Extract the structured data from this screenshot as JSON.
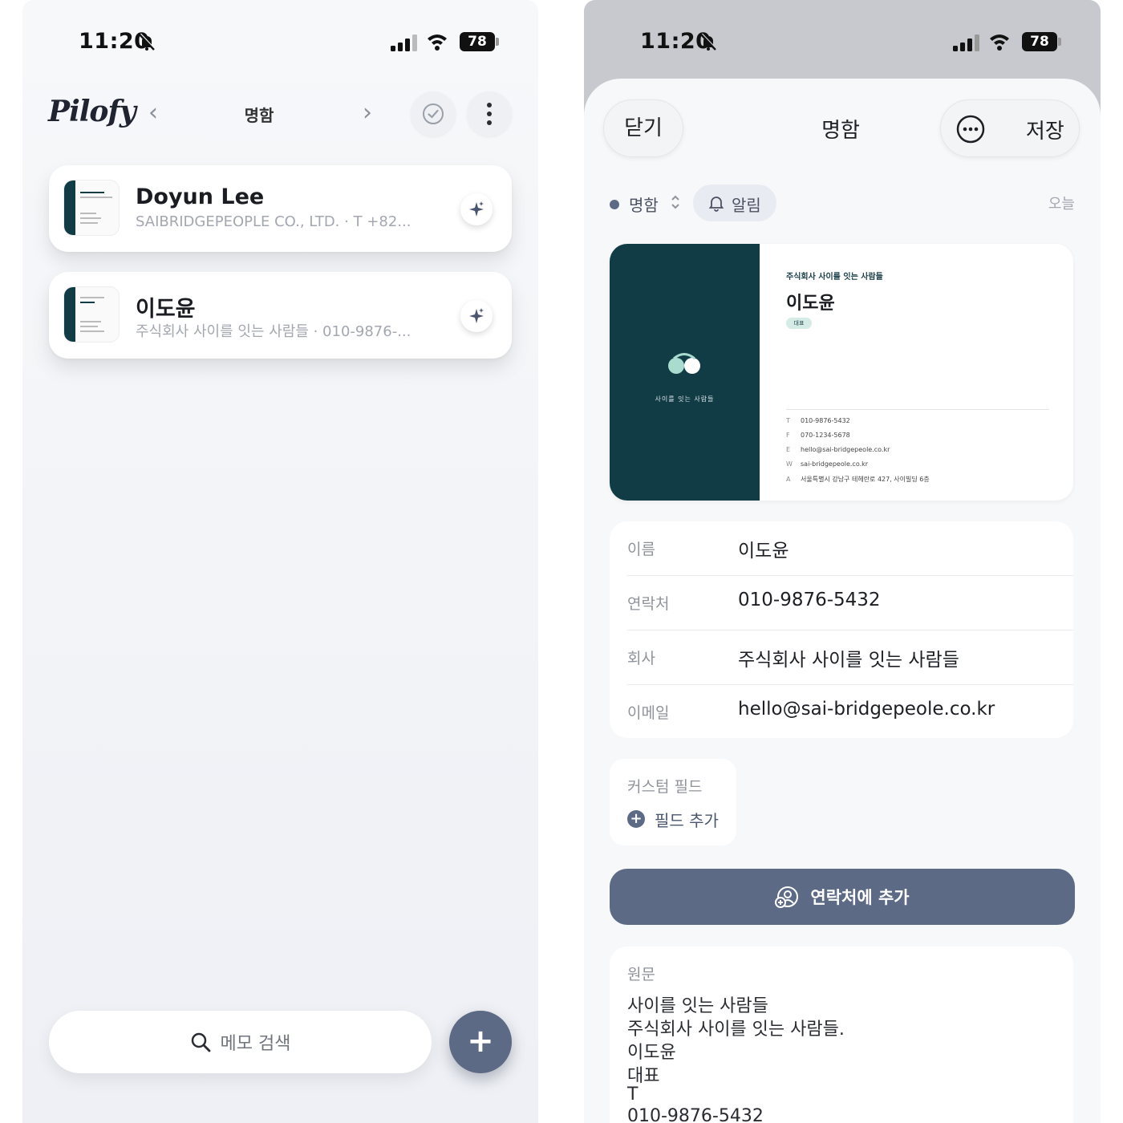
{
  "status_bar": {
    "time": "11:20",
    "battery": "78"
  },
  "left": {
    "logo": "Pilofy",
    "nav_prev": "‹",
    "nav_next": "›",
    "title": "명함",
    "cards": [
      {
        "name": "Doyun Lee",
        "subtitle": "SAIBRIDGEPEOPLE CO., LTD. · T +82..."
      },
      {
        "name": "이도윤",
        "subtitle": "주식회사 사이를 잇는 사람들 · 010-9876-..."
      }
    ],
    "search": {
      "placeholder": "메모 검색"
    },
    "fab": "+"
  },
  "right": {
    "close": "닫기",
    "title": "명함",
    "save": "저장",
    "meta": {
      "type": "명함",
      "alarm": "알림",
      "date": "오늘"
    },
    "card": {
      "dark_text": "사이를 잇는 사람들",
      "company": "주식회사 사이를 잇는 사람들",
      "name": "이도윤",
      "role": "대표",
      "lines": [
        {
          "k": "T",
          "v": "010-9876-5432"
        },
        {
          "k": "F",
          "v": "070-1234-5678"
        },
        {
          "k": "E",
          "v": "hello@sai-bridgepeole.co.kr"
        },
        {
          "k": "W",
          "v": "sai-bridgepeole.co.kr"
        },
        {
          "k": "A",
          "v": "서울특별시 강남구 테헤란로 427, 사이빌딩 6층"
        }
      ]
    },
    "fields": [
      {
        "label": "이름",
        "value": "이도윤"
      },
      {
        "label": "연락처",
        "value": "010-9876-5432"
      },
      {
        "label": "회사",
        "value": "주식회사 사이를 잇는 사람들"
      },
      {
        "label": "이메일",
        "value": "hello@sai-bridgepeole.co.kr"
      }
    ],
    "custom_field": {
      "label": "커스텀 필드",
      "add": "필드 추가"
    },
    "add_contact": "연락처에 추가",
    "original": {
      "label": "원문",
      "lines": [
        "사이를 잇는 사람들",
        "주식회사 사이를 잇는 사람들.",
        "이도윤",
        "대표",
        "T",
        "010-9876-5432"
      ]
    }
  },
  "colors": {
    "accent": "#5d6a85",
    "card_dark": "#113c46",
    "mint": "#a9dccf"
  }
}
